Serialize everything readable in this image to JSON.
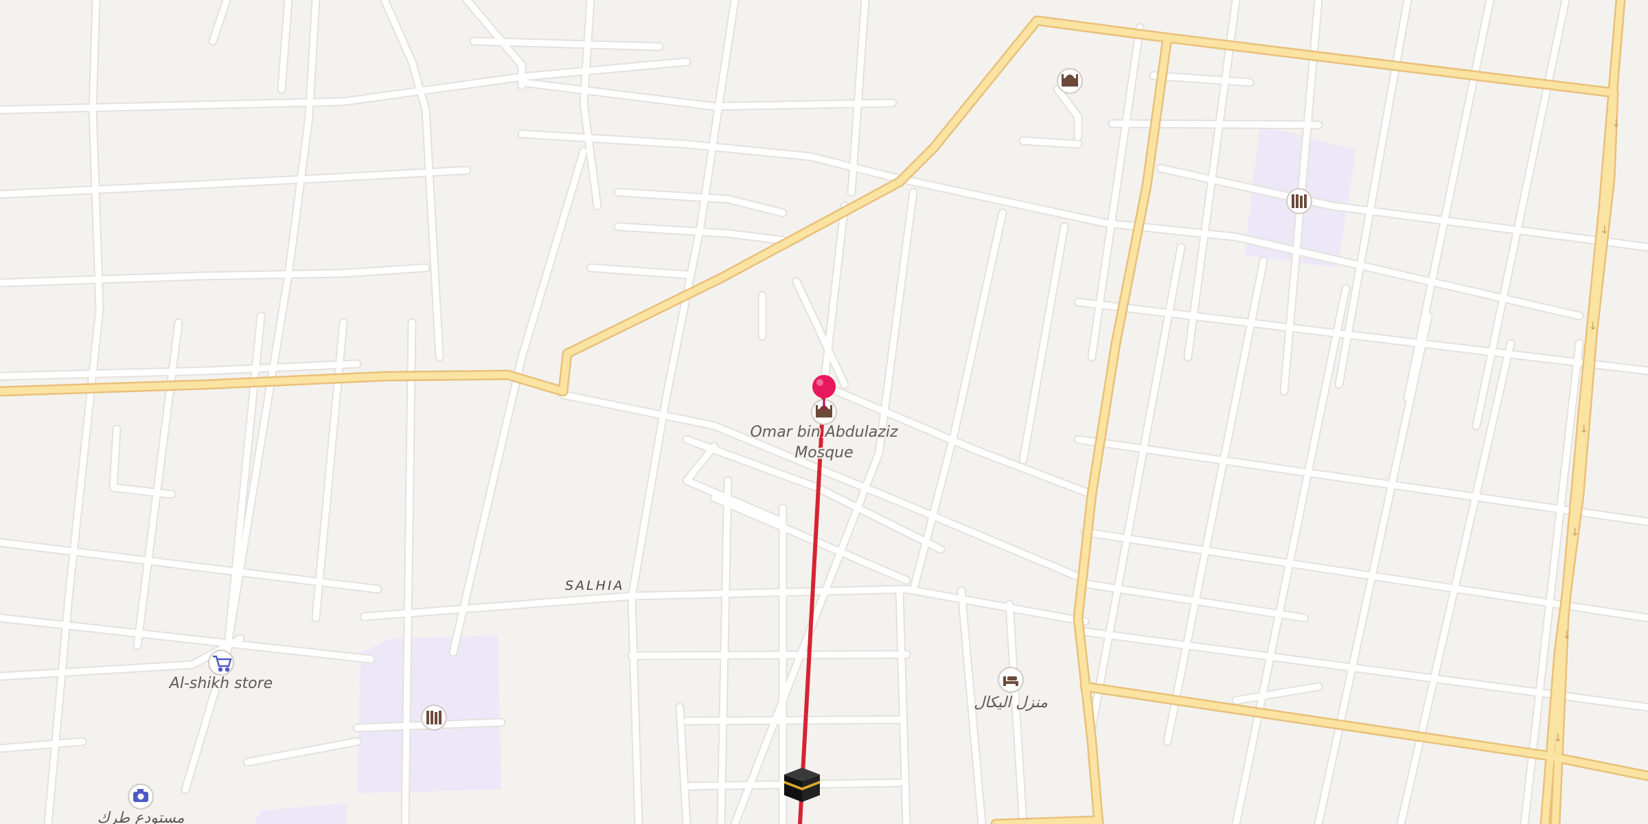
{
  "map": {
    "district_label": "SALHIA",
    "pois": [
      {
        "id": "mosque-selected",
        "icon": "mosque-icon",
        "label_lines": [
          "Omar bin Abdulaziz",
          "Mosque"
        ]
      },
      {
        "id": "store",
        "icon": "shopping-cart-icon",
        "label_lines": [
          "Al-shikh store"
        ]
      },
      {
        "id": "hotel",
        "icon": "bed-icon",
        "label_lines": [
          "منزل اليكال"
        ]
      },
      {
        "id": "warehouse",
        "icon": "camera-icon",
        "label_lines": [
          "مستودع طرك"
        ]
      },
      {
        "id": "mosque-ne",
        "icon": "mosque-icon",
        "label_lines": []
      },
      {
        "id": "school-ne",
        "icon": "school-icon",
        "label_lines": []
      },
      {
        "id": "school-sw",
        "icon": "school-icon",
        "label_lines": []
      },
      {
        "id": "kaaba-marker",
        "icon": "kaaba-icon",
        "label_lines": []
      }
    ],
    "selected_marker": {
      "icon": "location-pin-icon",
      "color": "#e8185f"
    },
    "route": {
      "color": "#d42433"
    },
    "colors": {
      "land": "#f4f2ef",
      "minor_road": "#ffffff",
      "major_road": "#fbe3a2",
      "major_road_casing": "#e8c07a",
      "school_area": "#ede8f8"
    }
  }
}
